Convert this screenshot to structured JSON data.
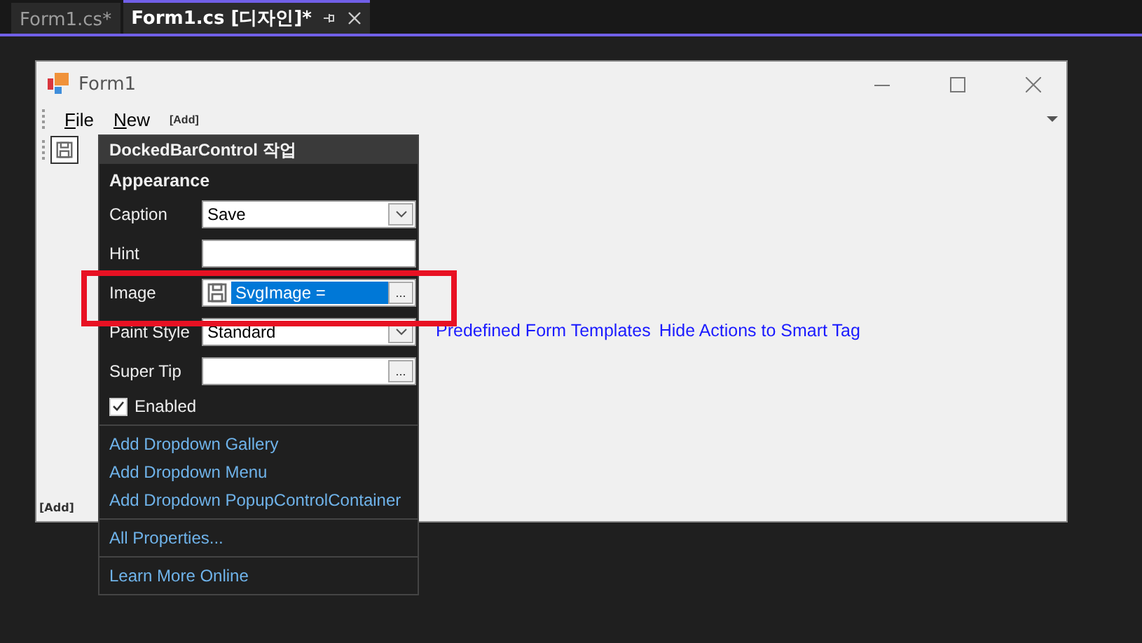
{
  "tabs": [
    {
      "label": "Form1.cs*",
      "selected": false
    },
    {
      "label": "Form1.cs [디자인]*",
      "selected": true
    }
  ],
  "form": {
    "title": "Form1",
    "menu": [
      "File",
      "New"
    ],
    "menu_add": "[Add]",
    "bottom_add": "[Add]",
    "links": [
      "Predefined Form Templates",
      "Hide Actions to Smart Tag"
    ]
  },
  "smart_tag": {
    "title": "DockedBarControl 작업",
    "section": "Appearance",
    "properties": [
      {
        "kind": "combo",
        "label": "Caption",
        "value": "Save",
        "highlighted": false
      },
      {
        "kind": "text",
        "label": "Hint",
        "highlighted": false
      },
      {
        "kind": "image",
        "label": "Image",
        "value": "SvgImage =",
        "button": "...",
        "highlighted": true
      },
      {
        "kind": "combo",
        "label": "Paint Style",
        "value": "Standard",
        "highlighted": false
      },
      {
        "kind": "ellipsis",
        "label": "Super Tip",
        "button": "...",
        "highlighted": false
      }
    ],
    "enabled": {
      "label": "Enabled",
      "checked": true
    },
    "action_groups": [
      [
        "Add Dropdown Gallery",
        "Add Dropdown Menu",
        "Add Dropdown PopupControlContainer"
      ],
      [
        "All Properties..."
      ],
      [
        "Learn More Online"
      ]
    ]
  }
}
